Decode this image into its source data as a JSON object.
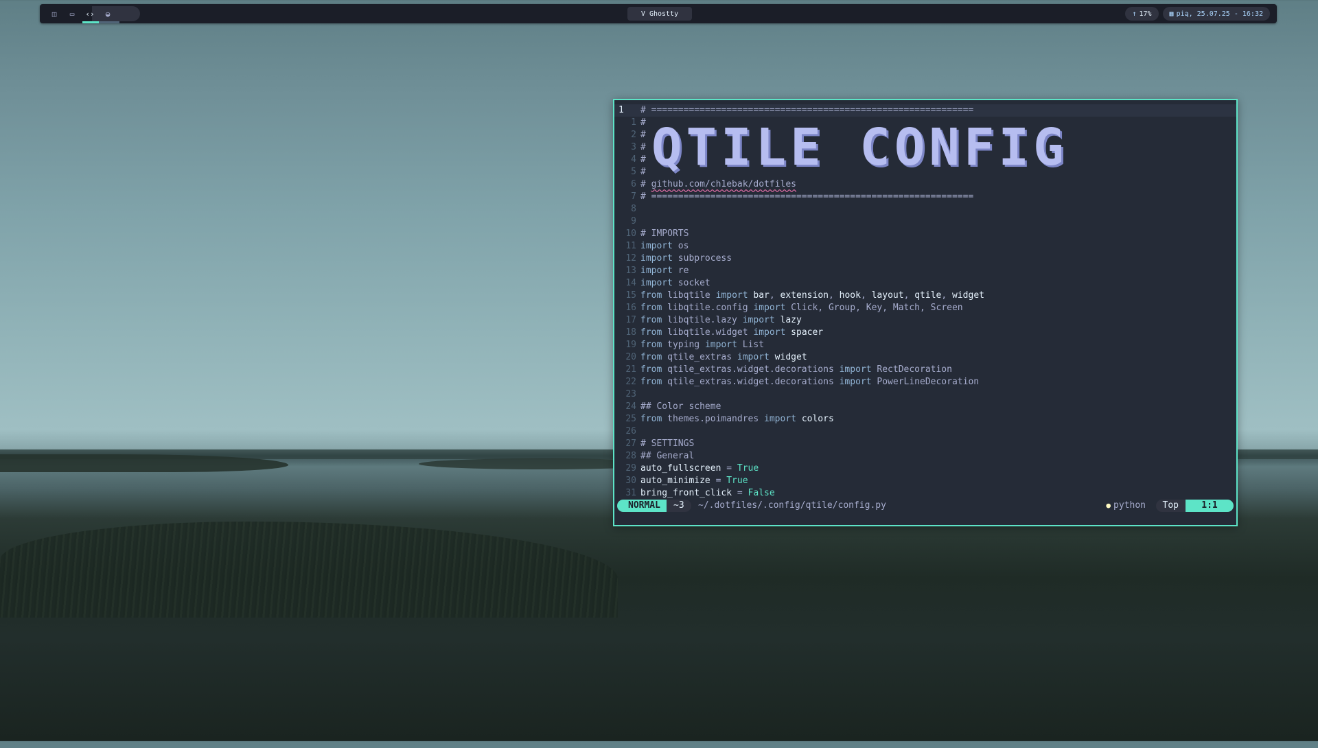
{
  "colors": {
    "accent": "#5de4c7",
    "bar_bg": "#1b1e28",
    "editor_bg": "#252b37",
    "banner": "#b6bdf0"
  },
  "topbar": {
    "workspaces": [
      {
        "icon": "split-layout-icon",
        "glyph": "◫"
      },
      {
        "icon": "window-icon",
        "glyph": "▭"
      },
      {
        "icon": "code-icon",
        "glyph": "‹›"
      },
      {
        "icon": "browser-icon",
        "glyph": "◒"
      }
    ],
    "window_title": "V Ghostty",
    "cpu": {
      "icon": "arrow-up-icon",
      "label": "17%"
    },
    "datetime": {
      "icon": "calendar-icon",
      "label": "pią, 25.07.25 - 16:32"
    }
  },
  "editor": {
    "banner_text": "QTILE CONFIG",
    "lines": [
      {
        "num": "1",
        "current": true,
        "parts": [
          [
            "cm",
            "# ============================================================"
          ]
        ]
      },
      {
        "num": "1",
        "parts": [
          [
            "cm",
            "#"
          ]
        ]
      },
      {
        "num": "2",
        "parts": [
          [
            "cm",
            "#"
          ]
        ]
      },
      {
        "num": "3",
        "parts": [
          [
            "cm",
            "#"
          ]
        ]
      },
      {
        "num": "4",
        "parts": [
          [
            "cm",
            "#"
          ]
        ]
      },
      {
        "num": "5",
        "parts": [
          [
            "cm",
            "#"
          ]
        ]
      },
      {
        "num": "6",
        "parts": [
          [
            "cm",
            "# "
          ],
          [
            "url",
            "github.com/ch1ebak/dotfiles"
          ]
        ]
      },
      {
        "num": "7",
        "parts": [
          [
            "cm",
            "# ============================================================"
          ]
        ]
      },
      {
        "num": "8",
        "parts": []
      },
      {
        "num": "9",
        "parts": []
      },
      {
        "num": "10",
        "parts": [
          [
            "cm",
            "# IMPORTS"
          ]
        ]
      },
      {
        "num": "11",
        "parts": [
          [
            "kw",
            "import"
          ],
          [
            "c",
            " os"
          ]
        ]
      },
      {
        "num": "12",
        "parts": [
          [
            "kw",
            "import"
          ],
          [
            "c",
            " subprocess"
          ]
        ]
      },
      {
        "num": "13",
        "parts": [
          [
            "kw",
            "import"
          ],
          [
            "c",
            " re"
          ]
        ]
      },
      {
        "num": "14",
        "parts": [
          [
            "kw",
            "import"
          ],
          [
            "c",
            " socket"
          ]
        ]
      },
      {
        "num": "15",
        "parts": [
          [
            "kw",
            "from"
          ],
          [
            "c",
            " libqtile "
          ],
          [
            "kw",
            "import"
          ],
          [
            "n",
            " bar"
          ],
          [
            "c",
            ", "
          ],
          [
            "n",
            "extension"
          ],
          [
            "c",
            ", "
          ],
          [
            "n",
            "hook"
          ],
          [
            "c",
            ", "
          ],
          [
            "n",
            "layout"
          ],
          [
            "c",
            ", "
          ],
          [
            "n",
            "qtile"
          ],
          [
            "c",
            ", "
          ],
          [
            "n",
            "widget"
          ]
        ]
      },
      {
        "num": "16",
        "parts": [
          [
            "kw",
            "from"
          ],
          [
            "c",
            " libqtile.config "
          ],
          [
            "kw",
            "import"
          ],
          [
            "c",
            " Click, Group, Key, Match, Screen"
          ]
        ]
      },
      {
        "num": "17",
        "parts": [
          [
            "kw",
            "from"
          ],
          [
            "c",
            " libqtile.lazy "
          ],
          [
            "kw",
            "import"
          ],
          [
            "n",
            " lazy"
          ]
        ]
      },
      {
        "num": "18",
        "parts": [
          [
            "kw",
            "from"
          ],
          [
            "c",
            " libqtile.widget "
          ],
          [
            "kw",
            "import"
          ],
          [
            "n",
            " spacer"
          ]
        ]
      },
      {
        "num": "19",
        "parts": [
          [
            "kw",
            "from"
          ],
          [
            "c",
            " typing "
          ],
          [
            "kw",
            "import"
          ],
          [
            "c",
            " List"
          ]
        ]
      },
      {
        "num": "20",
        "parts": [
          [
            "kw",
            "from"
          ],
          [
            "c",
            " qtile_extras "
          ],
          [
            "kw",
            "import"
          ],
          [
            "n",
            " widget"
          ]
        ]
      },
      {
        "num": "21",
        "parts": [
          [
            "kw",
            "from"
          ],
          [
            "c",
            " qtile_extras.widget.decorations "
          ],
          [
            "kw",
            "import"
          ],
          [
            "c",
            " RectDecoration"
          ]
        ]
      },
      {
        "num": "22",
        "parts": [
          [
            "kw",
            "from"
          ],
          [
            "c",
            " qtile_extras.widget.decorations "
          ],
          [
            "kw",
            "import"
          ],
          [
            "c",
            " PowerLineDecoration"
          ]
        ]
      },
      {
        "num": "23",
        "parts": []
      },
      {
        "num": "24",
        "parts": [
          [
            "cm",
            "## Color scheme"
          ]
        ]
      },
      {
        "num": "25",
        "parts": [
          [
            "kw",
            "from"
          ],
          [
            "c",
            " themes.poimandres "
          ],
          [
            "kw",
            "import"
          ],
          [
            "n",
            " colors"
          ]
        ]
      },
      {
        "num": "26",
        "parts": []
      },
      {
        "num": "27",
        "parts": [
          [
            "cm",
            "# SETTINGS"
          ]
        ]
      },
      {
        "num": "28",
        "parts": [
          [
            "cm",
            "## General"
          ]
        ]
      },
      {
        "num": "29",
        "parts": [
          [
            "n",
            "auto_fullscreen"
          ],
          [
            "c",
            " = "
          ],
          [
            "t",
            "True"
          ]
        ]
      },
      {
        "num": "30",
        "parts": [
          [
            "n",
            "auto_minimize"
          ],
          [
            "c",
            " = "
          ],
          [
            "t",
            "True"
          ]
        ]
      },
      {
        "num": "31",
        "parts": [
          [
            "n",
            "bring_front_click"
          ],
          [
            "c",
            " = "
          ],
          [
            "t",
            "False"
          ]
        ]
      }
    ]
  },
  "statusline": {
    "mode": "NORMAL",
    "branch": "~3",
    "path": "~/.dotfiles/.config/qtile/config.py",
    "filetype_icon": "python-icon",
    "filetype": "python",
    "scroll": "Top",
    "position": "1:1"
  }
}
